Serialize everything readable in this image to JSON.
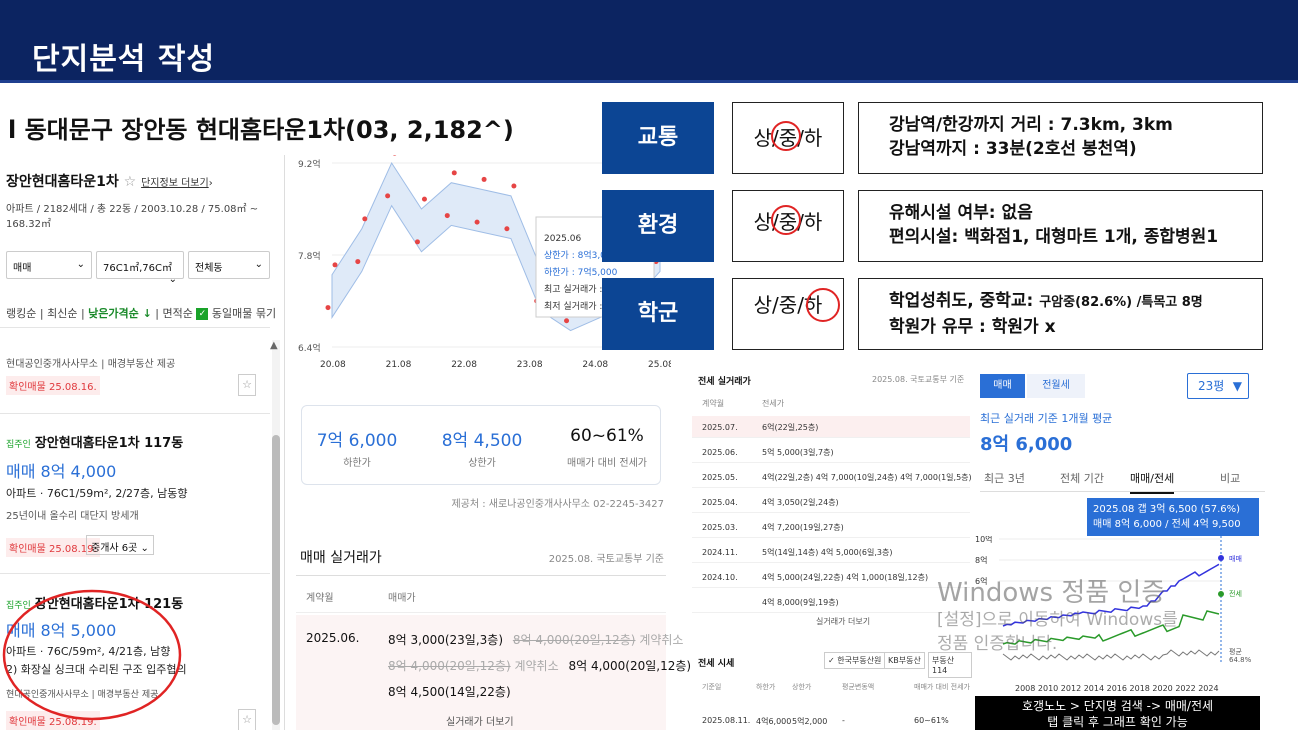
{
  "header": {
    "title": "단지분석 작성"
  },
  "location": "l 동대문구 장안동 현대홈타운1차(03, 2,182^)",
  "left_panel": {
    "complex_name": "장안현대홈타운1차",
    "more_link": "단지정보 더보기",
    "summary": "아파트 / 2182세대 / 총 22동 / 2003.10.28 / 75.08㎡ ~ 168.32㎡",
    "filters": [
      "매매",
      "76C1㎡,76C㎡",
      "전체동"
    ],
    "sort": {
      "rank": "랭킹순",
      "recent": "최신순",
      "low_price": "낮은가격순 ↓",
      "area": "면적순",
      "same": "동일매물 묶기"
    },
    "top_item": {
      "agency": "현대공인중개사사무소 | 매경부동산 제공",
      "confirm": "확인매물 25.08.16."
    },
    "card1": {
      "tag": "집주인",
      "title": "장안현대홈타운1차 117동",
      "price": "매매 8억 4,000",
      "info": "아파트 · 76C1/59m², 2/27층, 남동향",
      "features": "25년이내  올수리  대단지  방세개",
      "confirm": "확인매물 25.08.19.",
      "agents": "중개사 6곳"
    },
    "card2": {
      "tag": "집주인",
      "title": "장안현대홈타운1차 121동",
      "price": "매매 8억 5,000",
      "info": "아파트 · 76C/59m², 4/21층, 남향",
      "note": "2) 화장실 싱크대 수리된 구조 입주협의",
      "agency": "현대공인중개사사무소 | 매경부동산 제공",
      "confirm": "확인매물 25.08.19."
    }
  },
  "chart_data": {
    "type": "line",
    "x": [
      "20.08",
      "21.08",
      "22.08",
      "23.08",
      "24.08",
      "25.08"
    ],
    "ylabels": [
      "9.2억",
      "7.8억",
      "6.4억"
    ],
    "ylim": [
      6.4,
      9.2
    ],
    "series": [
      {
        "values": [
          7.2,
          7.9,
          8.9,
          8.2,
          8.6,
          8.5,
          8.4,
          7.3,
          7.0,
          7.2,
          7.4,
          7.9
        ]
      }
    ],
    "tooltip": {
      "date": "2025.06",
      "upper": "상한가 : 8억3,0",
      "lower": "하한가 : 7억5,000",
      "max": "최고 실거래가 :",
      "min": "최저 실거래가 :"
    }
  },
  "price_summary": {
    "low": "7억 6,000",
    "low_label": "하한가",
    "high": "8억 4,500",
    "high_label": "상한가",
    "ratio": "60~61%",
    "ratio_label": "매매가 대비 전세가"
  },
  "provider": "제공처 : 새로나공인중개사사무소 02-2245-3427",
  "sales": {
    "title": "매매 실거래가",
    "source": "2025.08. 국토교통부 기준",
    "col1": "계약월",
    "col2": "매매가",
    "month": "2025.06.",
    "l1a": "8억 3,000(23일,3층)",
    "l1b": "8억 4,000(20일,12층)",
    "l1c": "계약취소",
    "l2a": "8억 4,000(20일,12층)",
    "l2b": "계약취소",
    "l2c": "8억 4,000(20일,12층)",
    "l3": "8억 4,500(14일,22층)",
    "more": "실거래가 더보기"
  },
  "categories": [
    {
      "name": "교통",
      "level": "상/중/하",
      "d1": "강남역/한강까지 거리 : 7.3km, 3km",
      "d2": "강남역까지 : 33분(2호선 봉천역)"
    },
    {
      "name": "환경",
      "level": "상/중/하",
      "d1": "유해시설 여부: 없음",
      "d2": "편의시설: 백화점1, 대형마트 1개, 종합병원1"
    },
    {
      "name": "학군",
      "level": "상/중/하",
      "d1a": "학업성취도, 중학교: ",
      "d1b": "구암중(82.6%) /특목고 8명",
      "d2": "학원가 유무 : 학원가 x"
    }
  ],
  "jeonse": {
    "title": "전세 실거래가",
    "source": "2025.08. 국토교통부 기준",
    "col1": "계약월",
    "col2": "전세가",
    "rows": [
      [
        "2025.07.",
        "6억(22일,25층)"
      ],
      [
        "2025.06.",
        "5억 5,000(3일,7층)"
      ],
      [
        "2025.05.",
        "4억(22일,2층)   4억 7,000(10일,24층)   4억 7,000(1일,5층)"
      ],
      [
        "2025.04.",
        "4억 3,050(2일,24층)"
      ],
      [
        "2025.03.",
        "4억 7,200(19일,27층)"
      ],
      [
        "2024.11.",
        "5억(14일,14층)   4억 5,000(6일,3층)"
      ],
      [
        "2024.10.",
        "4억 5,000(24일,22층)   4억 1,000(18일,12층)"
      ],
      [
        "",
        "4억 8,000(9일,19층)"
      ]
    ],
    "more": "실거래가 더보기",
    "market_title": "전세 시세",
    "tabs": [
      "한국부동산원",
      "KB부동산",
      "부동산114"
    ],
    "mcols": [
      "기준일",
      "하한가",
      "상한가",
      "평균변동액",
      "매매가 대비 전세가"
    ],
    "mrow": [
      "2025.08.11.",
      "4억6,000",
      "5억2,000",
      "-",
      "60~61%"
    ]
  },
  "graph": {
    "btn_sale": "매매",
    "btn_jeonse": "전월세",
    "pyeong": "23평",
    "avg_label": "최근 실거래 기준 1개월 평균",
    "avg_value": "8억 6,000",
    "tabs": [
      "최근 3년",
      "전체 기간",
      "매매/전세",
      "비교"
    ],
    "tip1": "2025.08  갭 3억 6,500 (57.6%)",
    "tip2": "매매 8억 6,000 / 전세 4억 9,500",
    "y": [
      "10억",
      "8억",
      "6억"
    ],
    "legend_sale": "매매",
    "legend_jeonse": "전세",
    "avg_small": "평균",
    "avg_pct": "64.8%",
    "years": "2008 2010 2012 2014 2016 2018 2020 2022 2024",
    "cap1": "호갱노노 > 단지명 검색 -> 매매/전세",
    "cap2": "탭 클릭 후 그래프 확인 가능"
  },
  "watermark": {
    "line1": "Windows 정품 인증",
    "line2": "[설정]으로 이동하여 Windows를",
    "line3": "정품 인증합니다."
  }
}
